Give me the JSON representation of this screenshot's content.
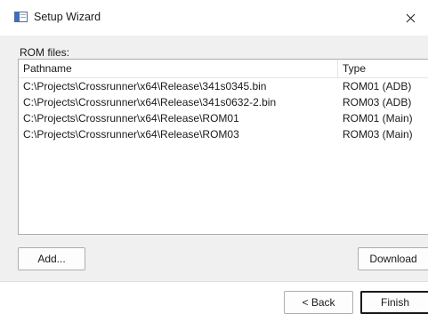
{
  "window": {
    "title": "Setup Wizard",
    "close_glyph": "×",
    "icon": "app-window-icon"
  },
  "rom_section": {
    "label": "ROM files:",
    "columns": [
      "Pathname",
      "Type"
    ],
    "rows": [
      {
        "pathname": "C:\\Projects\\Crossrunner\\x64\\Release\\341s0345.bin",
        "type": "ROM01 (ADB)"
      },
      {
        "pathname": "C:\\Projects\\Crossrunner\\x64\\Release\\341s0632-2.bin",
        "type": "ROM03 (ADB)"
      },
      {
        "pathname": "C:\\Projects\\Crossrunner\\x64\\Release\\ROM01",
        "type": "ROM01 (Main)"
      },
      {
        "pathname": "C:\\Projects\\Crossrunner\\x64\\Release\\ROM03",
        "type": "ROM03 (Main)"
      }
    ],
    "add_label": "Add...",
    "download_label": "Download"
  },
  "footer": {
    "back_label": "< Back",
    "finish_label": "Finish"
  },
  "colors": {
    "dialog_bg": "#f0f0f0",
    "list_bg": "#ffffff",
    "border": "#adadad"
  }
}
